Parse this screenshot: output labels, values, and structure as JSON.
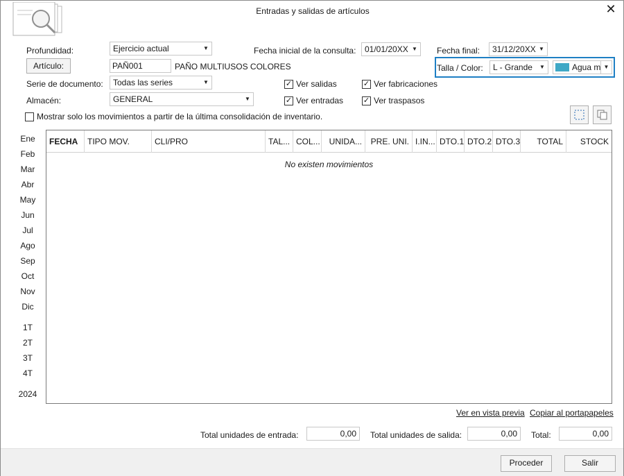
{
  "window": {
    "title": "Entradas y salidas de artículos",
    "close_icon": "close-icon"
  },
  "form": {
    "profundidad_label": "Profundidad:",
    "profundidad_value": "Ejercicio actual",
    "articulo_button": "Artículo:",
    "articulo_code": "PAÑ001",
    "articulo_name": "PAÑO MULTIUSOS COLORES",
    "serie_label": "Serie de documento:",
    "serie_value": "Todas las series",
    "almacen_label": "Almacén:",
    "almacen_value": "GENERAL",
    "fecha_inicial_label": "Fecha inicial de la consulta:",
    "fecha_inicial_value": "01/01/20XX",
    "fecha_final_label": "Fecha final:",
    "fecha_final_value": "31/12/20XX",
    "talla_color_label": "Talla / Color:",
    "talla_value": "L - Grande",
    "color_value": "Agua m",
    "color_swatch": "#3fa8c6",
    "ver_salidas": "Ver salidas",
    "ver_entradas": "Ver entradas",
    "ver_fabricaciones": "Ver fabricaciones",
    "ver_traspasos": "Ver traspasos",
    "mostrar_label": "Mostrar solo los movimientos a partir de la última consolidación de inventario."
  },
  "periods": {
    "months": [
      "Ene",
      "Feb",
      "Mar",
      "Abr",
      "May",
      "Jun",
      "Jul",
      "Ago",
      "Sep",
      "Oct",
      "Nov",
      "Dic"
    ],
    "quarters": [
      "1T",
      "2T",
      "3T",
      "4T"
    ],
    "year": "2024"
  },
  "grid": {
    "columns": [
      "FECHA",
      "TIPO MOV.",
      "CLI/PRO",
      "TAL...",
      "COL...",
      "UNIDA...",
      "PRE. UNI.",
      "I.IN...",
      "DTO.1",
      "DTO.2",
      "DTO.3",
      "TOTAL",
      "STOCK"
    ],
    "empty_message": "No existen movimientos"
  },
  "links": {
    "vista_previa": "Ver en vista previa",
    "portapapeles": "Copiar al portapapeles"
  },
  "totals": {
    "entrada_label": "Total unidades de entrada:",
    "entrada_value": "0,00",
    "salida_label": "Total unidades de salida:",
    "salida_value": "0,00",
    "total_label": "Total:",
    "total_value": "0,00"
  },
  "buttons": {
    "proceder": "Proceder",
    "salir": "Salir"
  }
}
